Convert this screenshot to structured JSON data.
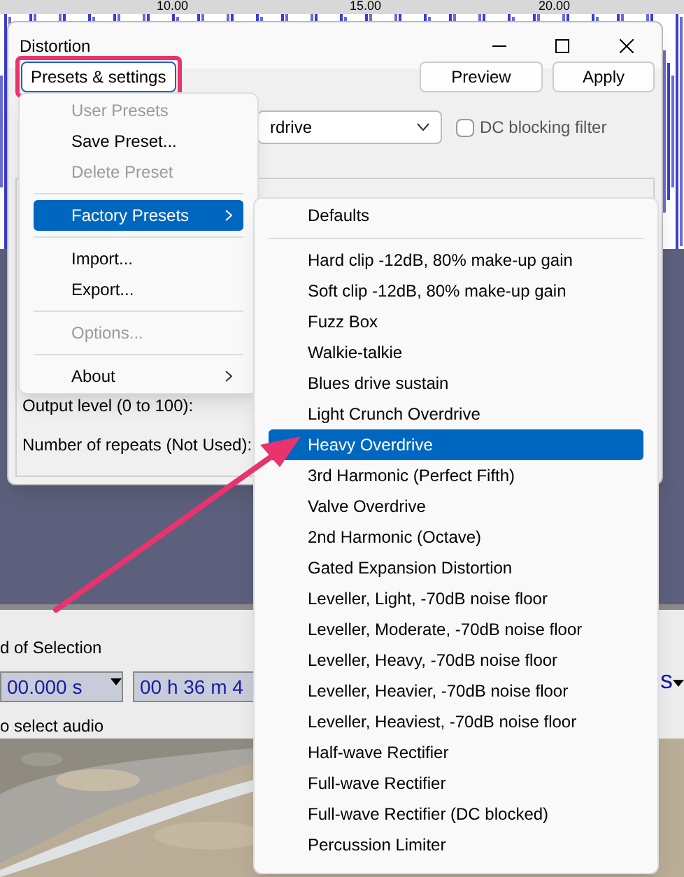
{
  "ruler": {
    "labels": [
      "10.00",
      "15.00",
      "20.00"
    ]
  },
  "dialog": {
    "title": "Distortion",
    "presets_button": "Presets & settings",
    "buttons": [
      "Preview",
      "Apply"
    ],
    "distortion_type": {
      "value": "rdrive"
    },
    "dc_filter": {
      "label": "DC blocking filter",
      "checked": false
    },
    "fields": [
      {
        "label": "Output level (0 to 100):"
      },
      {
        "label": "Number of repeats (Not Used):"
      }
    ]
  },
  "selection_toolbar": {
    "label": "d of Selection",
    "start": "00.000 s",
    "end": "00 h 36 m 4",
    "right_unit": "s",
    "status": "o select audio"
  },
  "menu": {
    "items": [
      {
        "kind": "item",
        "label": "User Presets",
        "disabled": true,
        "selected": false
      },
      {
        "kind": "item",
        "label": "Save Preset...",
        "disabled": false,
        "selected": false
      },
      {
        "kind": "item",
        "label": "Delete Preset",
        "disabled": true,
        "selected": false
      },
      {
        "kind": "separator"
      },
      {
        "kind": "submenu",
        "label": "Factory Presets",
        "disabled": false,
        "selected": true
      },
      {
        "kind": "separator"
      },
      {
        "kind": "item",
        "label": "Import...",
        "disabled": false,
        "selected": false
      },
      {
        "kind": "item",
        "label": "Export...",
        "disabled": false,
        "selected": false
      },
      {
        "kind": "separator"
      },
      {
        "kind": "item",
        "label": "Options...",
        "disabled": true,
        "selected": false
      },
      {
        "kind": "separator"
      },
      {
        "kind": "submenu",
        "label": "About",
        "disabled": false,
        "selected": false
      }
    ]
  },
  "submenu": {
    "items": [
      {
        "kind": "item",
        "label": "Defaults",
        "selected": false
      },
      {
        "kind": "separator"
      },
      {
        "kind": "item",
        "label": "Hard clip -12dB, 80% make-up gain",
        "selected": false
      },
      {
        "kind": "item",
        "label": "Soft clip -12dB, 80% make-up gain",
        "selected": false
      },
      {
        "kind": "item",
        "label": "Fuzz Box",
        "selected": false
      },
      {
        "kind": "item",
        "label": "Walkie-talkie",
        "selected": false
      },
      {
        "kind": "item",
        "label": "Blues drive sustain",
        "selected": false
      },
      {
        "kind": "item",
        "label": "Light Crunch Overdrive",
        "selected": false
      },
      {
        "kind": "item",
        "label": "Heavy Overdrive",
        "selected": true
      },
      {
        "kind": "item",
        "label": "3rd Harmonic (Perfect Fifth)",
        "selected": false
      },
      {
        "kind": "item",
        "label": "Valve Overdrive",
        "selected": false
      },
      {
        "kind": "item",
        "label": "2nd Harmonic (Octave)",
        "selected": false
      },
      {
        "kind": "item",
        "label": "Gated Expansion Distortion",
        "selected": false
      },
      {
        "kind": "item",
        "label": "Leveller, Light, -70dB noise floor",
        "selected": false
      },
      {
        "kind": "item",
        "label": "Leveller, Moderate, -70dB noise floor",
        "selected": false
      },
      {
        "kind": "item",
        "label": "Leveller, Heavy, -70dB noise floor",
        "selected": false
      },
      {
        "kind": "item",
        "label": "Leveller, Heavier, -70dB noise floor",
        "selected": false
      },
      {
        "kind": "item",
        "label": "Leveller, Heaviest, -70dB noise floor",
        "selected": false
      },
      {
        "kind": "item",
        "label": "Half-wave Rectifier",
        "selected": false
      },
      {
        "kind": "item",
        "label": "Full-wave Rectifier",
        "selected": false
      },
      {
        "kind": "item",
        "label": "Full-wave Rectifier (DC blocked)",
        "selected": false
      },
      {
        "kind": "item",
        "label": "Percussion Limiter",
        "selected": false
      }
    ]
  }
}
